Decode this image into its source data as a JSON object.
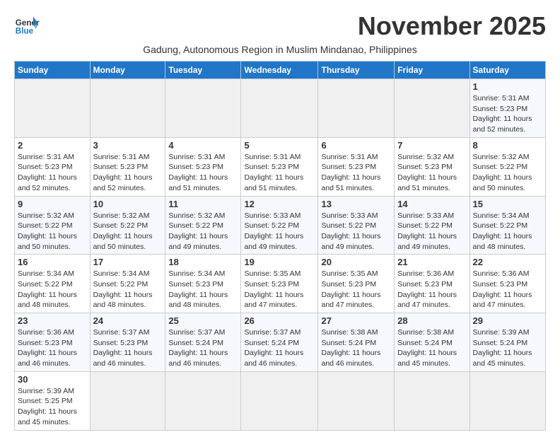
{
  "header": {
    "logo_general": "General",
    "logo_blue": "Blue",
    "month_title": "November 2025",
    "subtitle": "Gadung, Autonomous Region in Muslim Mindanao, Philippines"
  },
  "days_of_week": [
    "Sunday",
    "Monday",
    "Tuesday",
    "Wednesday",
    "Thursday",
    "Friday",
    "Saturday"
  ],
  "weeks": [
    [
      {
        "day": "",
        "info": ""
      },
      {
        "day": "",
        "info": ""
      },
      {
        "day": "",
        "info": ""
      },
      {
        "day": "",
        "info": ""
      },
      {
        "day": "",
        "info": ""
      },
      {
        "day": "",
        "info": ""
      },
      {
        "day": "1",
        "info": "Sunrise: 5:31 AM\nSunset: 5:23 PM\nDaylight: 11 hours\nand 52 minutes."
      }
    ],
    [
      {
        "day": "2",
        "info": "Sunrise: 5:31 AM\nSunset: 5:23 PM\nDaylight: 11 hours\nand 52 minutes."
      },
      {
        "day": "3",
        "info": "Sunrise: 5:31 AM\nSunset: 5:23 PM\nDaylight: 11 hours\nand 52 minutes."
      },
      {
        "day": "4",
        "info": "Sunrise: 5:31 AM\nSunset: 5:23 PM\nDaylight: 11 hours\nand 51 minutes."
      },
      {
        "day": "5",
        "info": "Sunrise: 5:31 AM\nSunset: 5:23 PM\nDaylight: 11 hours\nand 51 minutes."
      },
      {
        "day": "6",
        "info": "Sunrise: 5:31 AM\nSunset: 5:23 PM\nDaylight: 11 hours\nand 51 minutes."
      },
      {
        "day": "7",
        "info": "Sunrise: 5:32 AM\nSunset: 5:23 PM\nDaylight: 11 hours\nand 51 minutes."
      },
      {
        "day": "8",
        "info": "Sunrise: 5:32 AM\nSunset: 5:22 PM\nDaylight: 11 hours\nand 50 minutes."
      }
    ],
    [
      {
        "day": "9",
        "info": "Sunrise: 5:32 AM\nSunset: 5:22 PM\nDaylight: 11 hours\nand 50 minutes."
      },
      {
        "day": "10",
        "info": "Sunrise: 5:32 AM\nSunset: 5:22 PM\nDaylight: 11 hours\nand 50 minutes."
      },
      {
        "day": "11",
        "info": "Sunrise: 5:32 AM\nSunset: 5:22 PM\nDaylight: 11 hours\nand 49 minutes."
      },
      {
        "day": "12",
        "info": "Sunrise: 5:33 AM\nSunset: 5:22 PM\nDaylight: 11 hours\nand 49 minutes."
      },
      {
        "day": "13",
        "info": "Sunrise: 5:33 AM\nSunset: 5:22 PM\nDaylight: 11 hours\nand 49 minutes."
      },
      {
        "day": "14",
        "info": "Sunrise: 5:33 AM\nSunset: 5:22 PM\nDaylight: 11 hours\nand 49 minutes."
      },
      {
        "day": "15",
        "info": "Sunrise: 5:34 AM\nSunset: 5:22 PM\nDaylight: 11 hours\nand 48 minutes."
      }
    ],
    [
      {
        "day": "16",
        "info": "Sunrise: 5:34 AM\nSunset: 5:22 PM\nDaylight: 11 hours\nand 48 minutes."
      },
      {
        "day": "17",
        "info": "Sunrise: 5:34 AM\nSunset: 5:22 PM\nDaylight: 11 hours\nand 48 minutes."
      },
      {
        "day": "18",
        "info": "Sunrise: 5:34 AM\nSunset: 5:23 PM\nDaylight: 11 hours\nand 48 minutes."
      },
      {
        "day": "19",
        "info": "Sunrise: 5:35 AM\nSunset: 5:23 PM\nDaylight: 11 hours\nand 47 minutes."
      },
      {
        "day": "20",
        "info": "Sunrise: 5:35 AM\nSunset: 5:23 PM\nDaylight: 11 hours\nand 47 minutes."
      },
      {
        "day": "21",
        "info": "Sunrise: 5:36 AM\nSunset: 5:23 PM\nDaylight: 11 hours\nand 47 minutes."
      },
      {
        "day": "22",
        "info": "Sunrise: 5:36 AM\nSunset: 5:23 PM\nDaylight: 11 hours\nand 47 minutes."
      }
    ],
    [
      {
        "day": "23",
        "info": "Sunrise: 5:36 AM\nSunset: 5:23 PM\nDaylight: 11 hours\nand 46 minutes."
      },
      {
        "day": "24",
        "info": "Sunrise: 5:37 AM\nSunset: 5:23 PM\nDaylight: 11 hours\nand 46 minutes."
      },
      {
        "day": "25",
        "info": "Sunrise: 5:37 AM\nSunset: 5:24 PM\nDaylight: 11 hours\nand 46 minutes."
      },
      {
        "day": "26",
        "info": "Sunrise: 5:37 AM\nSunset: 5:24 PM\nDaylight: 11 hours\nand 46 minutes."
      },
      {
        "day": "27",
        "info": "Sunrise: 5:38 AM\nSunset: 5:24 PM\nDaylight: 11 hours\nand 46 minutes."
      },
      {
        "day": "28",
        "info": "Sunrise: 5:38 AM\nSunset: 5:24 PM\nDaylight: 11 hours\nand 45 minutes."
      },
      {
        "day": "29",
        "info": "Sunrise: 5:39 AM\nSunset: 5:24 PM\nDaylight: 11 hours\nand 45 minutes."
      }
    ],
    [
      {
        "day": "30",
        "info": "Sunrise: 5:39 AM\nSunset: 5:25 PM\nDaylight: 11 hours\nand 45 minutes."
      },
      {
        "day": "",
        "info": ""
      },
      {
        "day": "",
        "info": ""
      },
      {
        "day": "",
        "info": ""
      },
      {
        "day": "",
        "info": ""
      },
      {
        "day": "",
        "info": ""
      },
      {
        "day": "",
        "info": ""
      }
    ]
  ]
}
